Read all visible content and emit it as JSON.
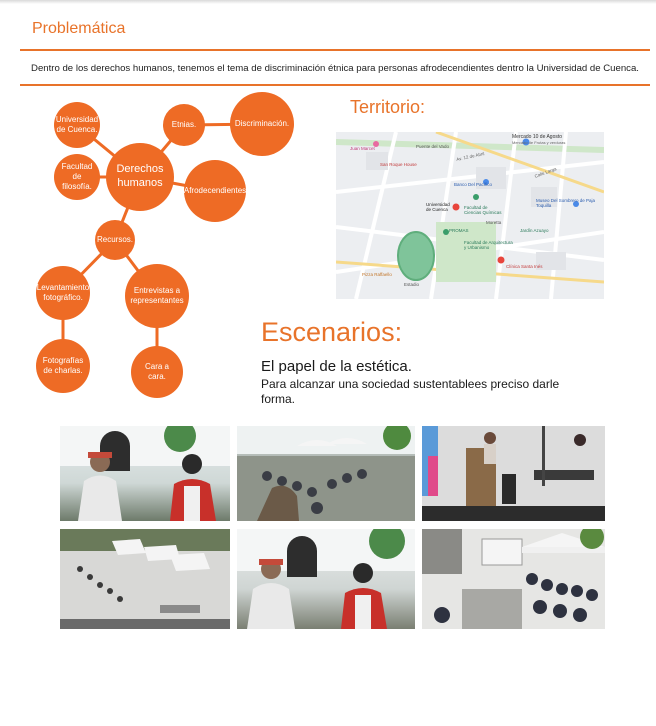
{
  "header": {
    "title": "Problemática"
  },
  "intro": "Dentro de los derechos humanos, tenemos el tema de discriminación étnica para personas afrodecendientes dentro la Universidad de Cuenca.",
  "mindmap": {
    "center": "Derechos humanos",
    "nodes": {
      "universidad": "Universidad de Cuenca.",
      "facultad": "Facultad de filosofía.",
      "etnias": "Etnias.",
      "discriminacion": "Discriminación.",
      "afro": "Afrodecendientes",
      "recursos": "Recursos.",
      "levantamiento": "Levantamiento fotográfico.",
      "entrevistas": "Entrevistas a representantes",
      "fotografias": "Fotografías de charlas.",
      "cara": "Cara a cara."
    },
    "color": "#ee6b25"
  },
  "territorio": {
    "heading": "Territorio:",
    "map_labels": {
      "mercado": "Mercado 10 de Agosto",
      "mercado_sub": "Mercado de Frutas y verduras",
      "puente": "Puente del Vado",
      "juan_marcet": "Juan Marcet",
      "san_roque": "San Roque House",
      "av_12": "Av. 12 de Abril",
      "calle_larga": "Calle Larga",
      "banco": "Banco Del Pacífico",
      "museo": "Museo Del Sombrero de Paja Toquilla",
      "uni": "Universidad de Cuenca",
      "fac_cc": "Facultad de Ciencias Químicas",
      "promas": "PROMAS",
      "jardin": "Jardín Azuayo",
      "fac_arq": "Facultad de Arquitectura y Urbanismo",
      "clinica": "Clínica Santa Inés",
      "pizza": "Pizza Raffaello",
      "estadio": "Estadio",
      "moretta": "Moretta"
    }
  },
  "escenarios": {
    "heading": "Escenarios:",
    "subheading": "El papel de la estética.",
    "text": "Para alcanzar una sociedad sustentablees preciso darle forma."
  },
  "photos": [
    "interview-photo-1",
    "courtyard-event-photo",
    "speaker-podium-photo",
    "aerial-tents-photo",
    "interview-photo-2",
    "audience-tent-photo"
  ]
}
